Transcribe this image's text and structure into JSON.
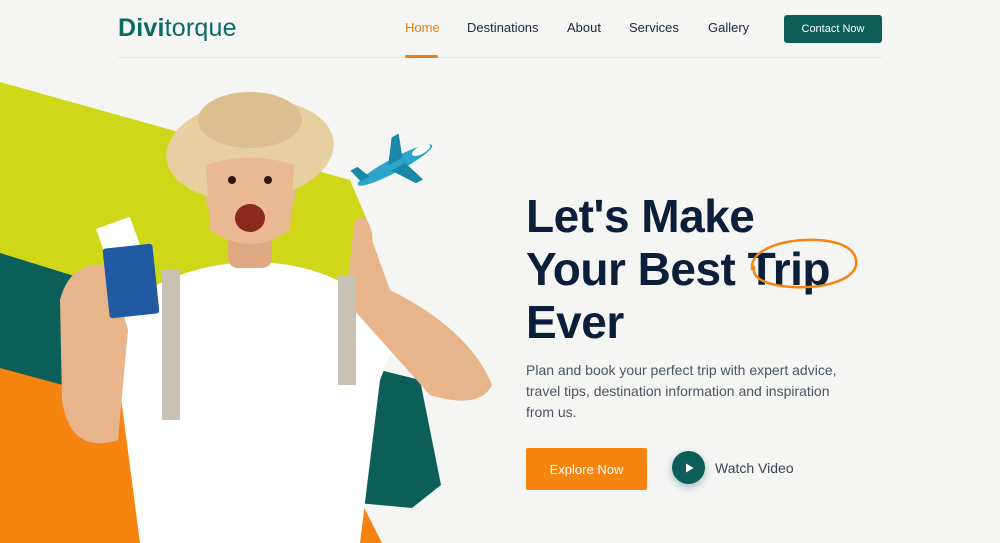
{
  "brand": {
    "logo_bold": "Divi",
    "logo_light": "torque"
  },
  "nav": {
    "items": [
      "Home",
      "Destinations",
      "About",
      "Services",
      "Gallery"
    ],
    "active": "Home",
    "contact_label": "Contact Now"
  },
  "hero": {
    "headline_line1": "Let's Make",
    "headline_line2": "Your Best Trip",
    "headline_line3": "Ever",
    "highlight_word": "Trip",
    "description": "Plan and book your perfect trip with expert advice, travel tips, destination information and inspiration from us.",
    "explore_label": "Explore Now",
    "watch_label": "Watch Video"
  },
  "colors": {
    "accent_orange": "#f58410",
    "brand_teal": "#0b5f58",
    "lime": "#cfd718",
    "headline": "#0b1f3a"
  },
  "icons": [
    "airplane-icon",
    "play-icon",
    "passport-icon"
  ]
}
